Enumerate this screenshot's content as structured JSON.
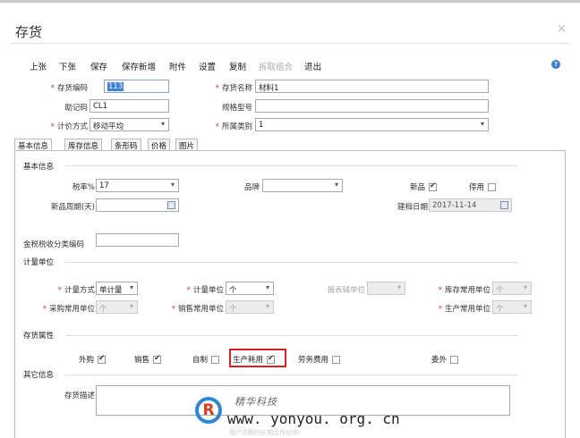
{
  "window": {
    "title": "存货",
    "close": "×"
  },
  "toolbar": [
    {
      "label": "上张",
      "enabled": true
    },
    {
      "label": "下张",
      "enabled": true
    },
    {
      "label": "保存",
      "enabled": true
    },
    {
      "label": "保存新增",
      "enabled": true
    },
    {
      "label": "附件",
      "enabled": true
    },
    {
      "label": "设置",
      "enabled": true
    },
    {
      "label": "复制",
      "enabled": true
    },
    {
      "label": "拆取组合",
      "enabled": false
    },
    {
      "label": "退出",
      "enabled": true
    }
  ],
  "help_icon": "?",
  "header": {
    "code_label": "存货编码",
    "code_value": "113",
    "name_label": "存货名称",
    "name_value": "材料1",
    "mnemonic_label": "助记码",
    "mnemonic_value": "CL1",
    "spec_label": "规格型号",
    "spec_value": "",
    "pricing_label": "计价方式",
    "pricing_value": "移动平均",
    "category_label": "所属类别",
    "category_value": "1"
  },
  "tabs": [
    "基本信息",
    "库存信息",
    "条形码",
    "价格",
    "图片"
  ],
  "active_tab": 0,
  "basic": {
    "section_title": "基本信息",
    "tax_label": "税率%",
    "tax_value": "17",
    "brand_label": "品牌",
    "brand_value": "",
    "new_label": "新品",
    "new_checked": true,
    "disabled_label": "停用",
    "disabled_checked": false,
    "new_period_label": "新品周期(天)",
    "new_period_value": "",
    "created_label": "建档日期",
    "created_value": "2017-11-14",
    "tax_code_label": "金税税收分类编码",
    "tax_code_value": ""
  },
  "units": {
    "section_title": "计量单位",
    "method_label": "计量方式",
    "method_value": "单计量",
    "unit_label": "计量单位",
    "unit_value": "个",
    "aux_label": "报表辅单位",
    "aux_value": "",
    "stock_unit_label": "库存常用单位",
    "stock_unit_value": "个",
    "purchase_unit_label": "采购常用单位",
    "purchase_unit_value": "个",
    "sales_unit_label": "销售常用单位",
    "sales_unit_value": "个",
    "prod_unit_label": "生产常用单位",
    "prod_unit_value": "个"
  },
  "attrs": {
    "section_title": "存货属性",
    "items": [
      {
        "label": "外购",
        "checked": true
      },
      {
        "label": "销售",
        "checked": true
      },
      {
        "label": "自制",
        "checked": false
      },
      {
        "label": "生产耗用",
        "checked": true
      },
      {
        "label": "劳务费用",
        "checked": false
      },
      {
        "label": "委外",
        "checked": false
      }
    ]
  },
  "other": {
    "section_title": "其它信息",
    "desc_label": "存货描述",
    "desc_value": ""
  },
  "watermark": {
    "logo": "R",
    "line1": "精华科技",
    "line2": "www. yonyou. org. cn",
    "line3": "用户信赖的长期合作伙伴"
  }
}
